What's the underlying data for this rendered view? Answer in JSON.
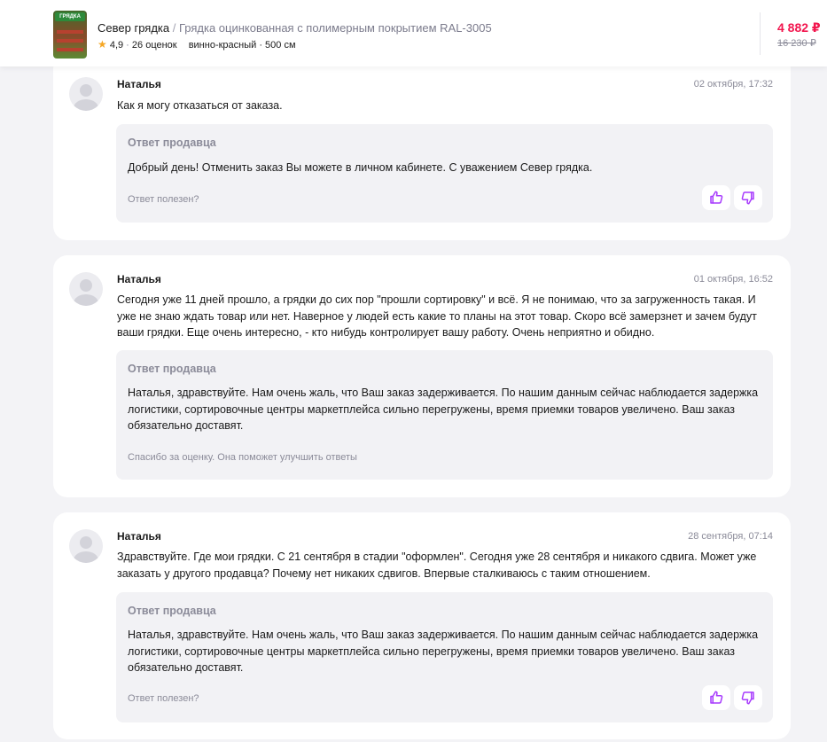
{
  "header": {
    "brand": "Север грядка",
    "separator": " / ",
    "product": "Грядка оцинкованная с полимерным покрытием RAL-3005",
    "rating": "4,9",
    "meta_dot": " · ",
    "reviews": "26 оценок",
    "variant": "винно-красный · 500 см",
    "price": "4 882 ₽",
    "old_price": "16 230 ₽",
    "thumb_label": "ГРЯДКА"
  },
  "colors": {
    "accent": "#f2164e",
    "vote_icon": "#a73afd",
    "muted": "#8b8b99"
  },
  "questions": [
    {
      "author": "Наталья",
      "date": "02 октября, 17:32",
      "text": "Как я могу отказаться от заказа.",
      "reply_title": "Ответ продавца",
      "reply_text": "Добрый день! Отменить заказ Вы можете в личном кабинете. С уважением Север грядка.",
      "footer": "Ответ полезен?",
      "votes_shown": true
    },
    {
      "author": "Наталья",
      "date": "01 октября, 16:52",
      "text": "Сегодня уже 11 дней прошло, а грядки до сих пор \"прошли сортировку\" и всё. Я не понимаю, что за загруженность такая. И уже не знаю ждать товар или нет. Наверное у людей есть какие то планы на этот товар. Скоро всё замерзнет и зачем будут ваши грядки. Еще очень интересно, - кто нибудь контролирует вашу работу. Очень неприятно и обидно.",
      "reply_title": "Ответ продавца",
      "reply_text": "Наталья, здравствуйте. Нам очень жаль, что Ваш заказ задерживается. По нашим данным сейчас наблюдается задержка логистики, сортировочные центры маркетплейса сильно перегружены, время приемки товаров увеличено. Ваш заказ обязательно доставят.",
      "footer": "Спасибо за оценку. Она поможет улучшить ответы",
      "votes_shown": false
    },
    {
      "author": "Наталья",
      "date": "28 сентября, 07:14",
      "text": "Здравствуйте. Где мои грядки. С 21 сентября в стадии \"оформлен\". Сегодня уже 28 сентября и никакого сдвига. Может уже заказать у другого продавца? Почему нет никаких сдвигов. Впервые сталкиваюсь с таким отношением.",
      "reply_title": "Ответ продавца",
      "reply_text": "Наталья, здравствуйте. Нам очень жаль, что Ваш заказ задерживается. По нашим данным сейчас наблюдается задержка логистики, сортировочные центры маркетплейса сильно перегружены, время приемки товаров увеличено. Ваш заказ обязательно доставят.",
      "footer": "Ответ полезен?",
      "votes_shown": true
    }
  ]
}
